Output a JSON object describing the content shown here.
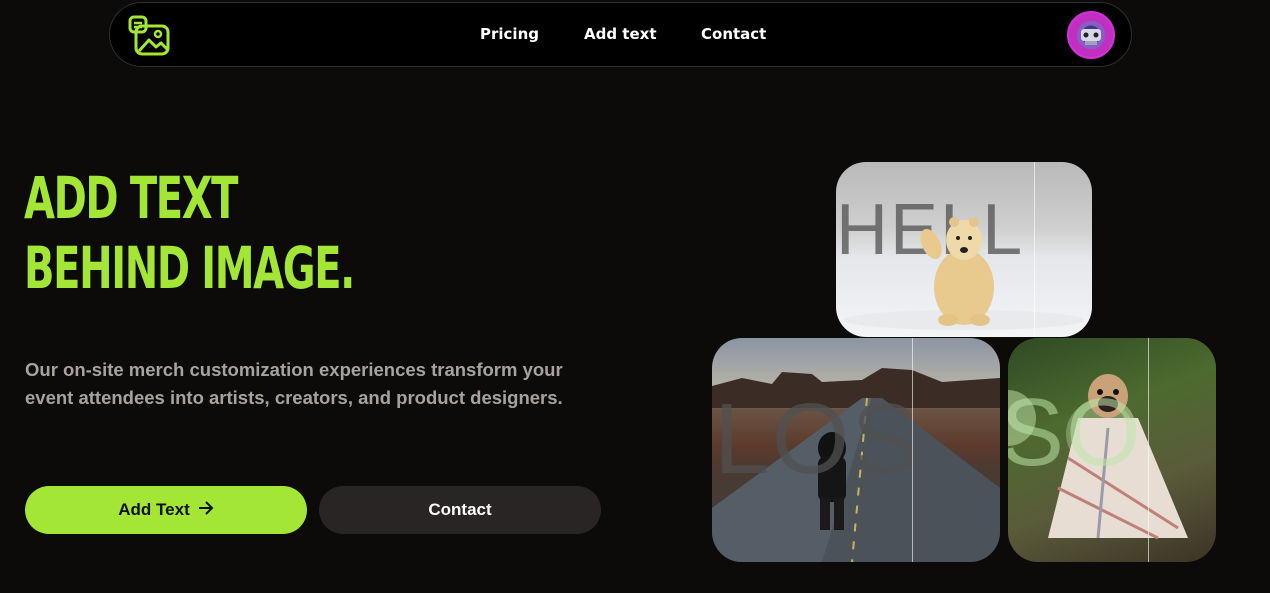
{
  "nav": {
    "links": [
      "Pricing",
      "Add text",
      "Contact"
    ],
    "logo_icon": "image-text-logo-icon",
    "avatar_icon": "avatar"
  },
  "hero": {
    "title_line1": "ADD TEXT",
    "title_line2": "BEHIND IMAGE.",
    "description": "Our on-site merch customization experiences transform your event attendees into artists, creators, and product designers.",
    "primary_button": "Add Text",
    "primary_button_icon": "arrow-right-icon",
    "secondary_button": "Contact"
  },
  "gallery": {
    "bear_text": "HELL",
    "road_text": "LOS",
    "pug_text": "SO"
  },
  "colors": {
    "background": "#0d0b0a",
    "accent": "#a3e635",
    "muted_text": "#a8a29e",
    "secondary_button": "#292524"
  }
}
